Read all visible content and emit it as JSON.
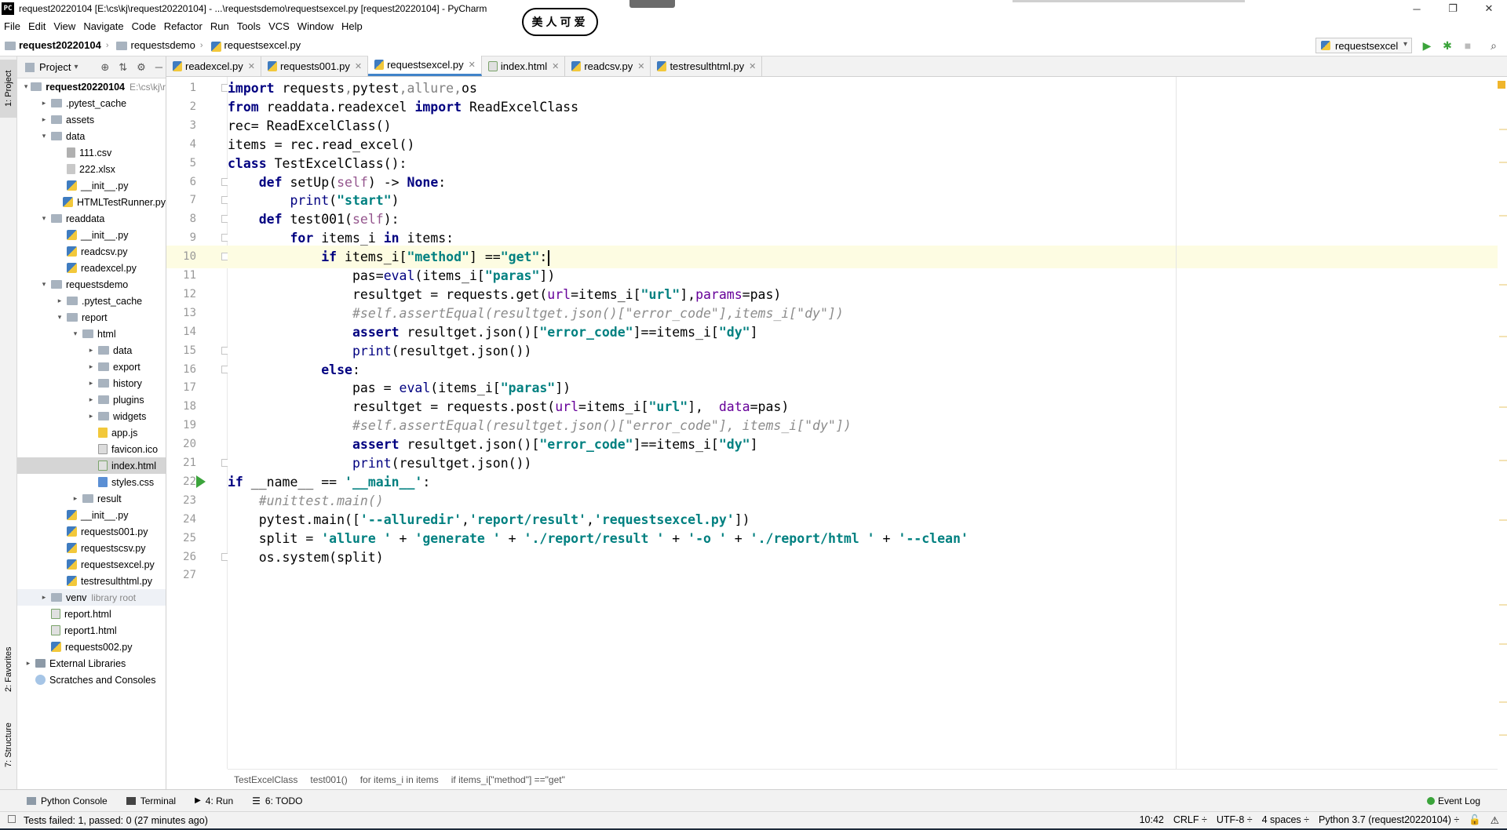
{
  "window": {
    "title": "request20220104 [E:\\cs\\kj\\request20220104] - ...\\requestsdemo\\requestsexcel.py [request20220104] - PyCharm",
    "app_icon_text": "PC",
    "controls": [
      "─",
      "❐",
      "✕"
    ],
    "stamp_text": "美人可爱"
  },
  "menu": [
    "File",
    "Edit",
    "View",
    "Navigate",
    "Code",
    "Refactor",
    "Run",
    "Tools",
    "VCS",
    "Window",
    "Help"
  ],
  "breadcrumb": [
    "request20220104",
    "requestsdemo",
    "requestsexcel.py"
  ],
  "run_config": "requestsexcel",
  "left_stripe": {
    "project": "1: Project",
    "favorites": "2: Favorites",
    "structure": "7: Structure"
  },
  "project_panel": {
    "title": "Project",
    "tree": [
      {
        "label": "request20220104",
        "hint": "E:\\cs\\kj\\r",
        "icon": "folder",
        "level": 0,
        "arrow": "▾",
        "bold": true
      },
      {
        "label": ".pytest_cache",
        "icon": "folder",
        "level": 1,
        "arrow": "▸"
      },
      {
        "label": "assets",
        "icon": "folder",
        "level": 1,
        "arrow": "▸"
      },
      {
        "label": "data",
        "icon": "folder",
        "level": 1,
        "arrow": "▾"
      },
      {
        "label": "111.csv",
        "icon": "csv",
        "level": 2,
        "arrow": ""
      },
      {
        "label": "222.xlsx",
        "icon": "xlsx",
        "level": 2,
        "arrow": ""
      },
      {
        "label": "__init__.py",
        "icon": "py",
        "level": 2,
        "arrow": ""
      },
      {
        "label": "HTMLTestRunner.py",
        "icon": "py",
        "level": 2,
        "arrow": ""
      },
      {
        "label": "readdata",
        "icon": "folder",
        "level": 1,
        "arrow": "▾"
      },
      {
        "label": "__init__.py",
        "icon": "py",
        "level": 2,
        "arrow": ""
      },
      {
        "label": "readcsv.py",
        "icon": "py",
        "level": 2,
        "arrow": ""
      },
      {
        "label": "readexcel.py",
        "icon": "py",
        "level": 2,
        "arrow": ""
      },
      {
        "label": "requestsdemo",
        "icon": "folder",
        "level": 1,
        "arrow": "▾"
      },
      {
        "label": ".pytest_cache",
        "icon": "folder",
        "level": 2,
        "arrow": "▸"
      },
      {
        "label": "report",
        "icon": "folder",
        "level": 2,
        "arrow": "▾"
      },
      {
        "label": "html",
        "icon": "folder",
        "level": 3,
        "arrow": "▾"
      },
      {
        "label": "data",
        "icon": "folder",
        "level": 4,
        "arrow": "▸"
      },
      {
        "label": "export",
        "icon": "folder",
        "level": 4,
        "arrow": "▸"
      },
      {
        "label": "history",
        "icon": "folder",
        "level": 4,
        "arrow": "▸"
      },
      {
        "label": "plugins",
        "icon": "folder",
        "level": 4,
        "arrow": "▸"
      },
      {
        "label": "widgets",
        "icon": "folder",
        "level": 4,
        "arrow": "▸"
      },
      {
        "label": "app.js",
        "icon": "js",
        "level": 4,
        "arrow": ""
      },
      {
        "label": "favicon.ico",
        "icon": "ico",
        "level": 4,
        "arrow": ""
      },
      {
        "label": "index.html",
        "icon": "html",
        "level": 4,
        "arrow": "",
        "selected": true
      },
      {
        "label": "styles.css",
        "icon": "css",
        "level": 4,
        "arrow": ""
      },
      {
        "label": "result",
        "icon": "folder",
        "level": 3,
        "arrow": "▸"
      },
      {
        "label": "__init__.py",
        "icon": "py",
        "level": 2,
        "arrow": ""
      },
      {
        "label": "requests001.py",
        "icon": "py",
        "level": 2,
        "arrow": ""
      },
      {
        "label": "requestscsv.py",
        "icon": "py",
        "level": 2,
        "arrow": ""
      },
      {
        "label": "requestsexcel.py",
        "icon": "py",
        "level": 2,
        "arrow": ""
      },
      {
        "label": "testresulthtml.py",
        "icon": "py",
        "level": 2,
        "arrow": ""
      },
      {
        "label": "venv",
        "hint": "library root",
        "icon": "folder",
        "level": 1,
        "arrow": "▸",
        "shaded": true
      },
      {
        "label": "report.html",
        "icon": "html",
        "level": 1,
        "arrow": ""
      },
      {
        "label": "report1.html",
        "icon": "html",
        "level": 1,
        "arrow": ""
      },
      {
        "label": "requests002.py",
        "icon": "py",
        "level": 1,
        "arrow": ""
      },
      {
        "label": "External Libraries",
        "icon": "lib",
        "level": 0,
        "arrow": "▸"
      },
      {
        "label": "Scratches and Consoles",
        "icon": "scratch",
        "level": 0,
        "arrow": ""
      }
    ]
  },
  "tabs": [
    {
      "label": "readexcel.py",
      "icon": "py"
    },
    {
      "label": "requests001.py",
      "icon": "py"
    },
    {
      "label": "requestsexcel.py",
      "icon": "py",
      "active": true
    },
    {
      "label": "index.html",
      "icon": "html"
    },
    {
      "label": "readcsv.py",
      "icon": "py"
    },
    {
      "label": "testresulthtml.py",
      "icon": "py"
    }
  ],
  "editor": {
    "current_line": 10,
    "run_line": 22,
    "fold_lines": [
      1,
      6,
      7,
      8,
      9,
      10,
      15,
      16,
      21,
      26
    ],
    "lines": [
      [
        [
          "kw",
          "import"
        ],
        [
          "t",
          " requests"
        ],
        [
          "dim",
          ","
        ],
        [
          "t",
          "pytest"
        ],
        [
          "dim",
          ","
        ],
        [
          "dim",
          "allure"
        ],
        [
          "dim",
          ","
        ],
        [
          "t",
          "os"
        ]
      ],
      [
        [
          "kw",
          "from"
        ],
        [
          "t",
          " readdata.readexcel "
        ],
        [
          "kw",
          "import"
        ],
        [
          "t",
          " ReadExcelClass"
        ]
      ],
      [
        [
          "t",
          "rec= ReadExcelClass()"
        ]
      ],
      [
        [
          "t",
          "items = rec.read_excel()"
        ]
      ],
      [
        [
          "kw",
          "class"
        ],
        [
          "t",
          " TestExcelClass():"
        ]
      ],
      [
        [
          "t",
          "    "
        ],
        [
          "kw",
          "def"
        ],
        [
          "t",
          " setUp("
        ],
        [
          "self",
          "self"
        ],
        [
          "t",
          ") -> "
        ],
        [
          "kw",
          "None"
        ],
        [
          "t",
          ":"
        ]
      ],
      [
        [
          "t",
          "        "
        ],
        [
          "builtin",
          "print"
        ],
        [
          "t",
          "("
        ],
        [
          "str",
          "\"start\""
        ],
        [
          "t",
          ")"
        ]
      ],
      [
        [
          "t",
          "    "
        ],
        [
          "kw",
          "def"
        ],
        [
          "t",
          " test001("
        ],
        [
          "self",
          "self"
        ],
        [
          "t",
          "):"
        ]
      ],
      [
        [
          "t",
          "        "
        ],
        [
          "kw",
          "for"
        ],
        [
          "t",
          " items_i "
        ],
        [
          "kw",
          "in"
        ],
        [
          "t",
          " items:"
        ]
      ],
      [
        [
          "t",
          "            "
        ],
        [
          "kw",
          "if"
        ],
        [
          "t",
          " items_i["
        ],
        [
          "str",
          "\"method\""
        ],
        [
          "t",
          "] =="
        ],
        [
          "str",
          "\"get\""
        ],
        [
          "t",
          ":"
        ],
        [
          "caret",
          ""
        ]
      ],
      [
        [
          "t",
          "                pas="
        ],
        [
          "builtin",
          "eval"
        ],
        [
          "t",
          "(items_i["
        ],
        [
          "str",
          "\"paras\""
        ],
        [
          "t",
          "])"
        ]
      ],
      [
        [
          "t",
          "                resultget = requests.get("
        ],
        [
          "param",
          "url"
        ],
        [
          "t",
          "=items_i["
        ],
        [
          "str",
          "\"url\""
        ],
        [
          "t",
          "],"
        ],
        [
          "param",
          "params"
        ],
        [
          "t",
          "=pas)"
        ]
      ],
      [
        [
          "t",
          "                "
        ],
        [
          "cmt",
          "#self.assertEqual(resultget.json()[\"error_code\"],items_i[\"dy\"])"
        ]
      ],
      [
        [
          "t",
          "                "
        ],
        [
          "kw",
          "assert"
        ],
        [
          "t",
          " resultget.json()["
        ],
        [
          "str",
          "\"error_code\""
        ],
        [
          "t",
          "]==items_i["
        ],
        [
          "str",
          "\"dy\""
        ],
        [
          "t",
          "]"
        ]
      ],
      [
        [
          "t",
          "                "
        ],
        [
          "builtin",
          "print"
        ],
        [
          "t",
          "(resultget.json())"
        ]
      ],
      [
        [
          "t",
          "            "
        ],
        [
          "kw",
          "else"
        ],
        [
          "t",
          ":"
        ]
      ],
      [
        [
          "t",
          "                pas = "
        ],
        [
          "builtin",
          "eval"
        ],
        [
          "t",
          "(items_i["
        ],
        [
          "str",
          "\"paras\""
        ],
        [
          "t",
          "])"
        ]
      ],
      [
        [
          "t",
          "                resultget = requests.post("
        ],
        [
          "param",
          "url"
        ],
        [
          "t",
          "=items_i["
        ],
        [
          "str",
          "\"url\""
        ],
        [
          "t",
          "],  "
        ],
        [
          "param",
          "data"
        ],
        [
          "t",
          "=pas)"
        ]
      ],
      [
        [
          "t",
          "                "
        ],
        [
          "cmt",
          "#self.assertEqual(resultget.json()[\"error_code\"], items_i[\"dy\"])"
        ]
      ],
      [
        [
          "t",
          "                "
        ],
        [
          "kw",
          "assert"
        ],
        [
          "t",
          " resultget.json()["
        ],
        [
          "str",
          "\"error_code\""
        ],
        [
          "t",
          "]==items_i["
        ],
        [
          "str",
          "\"dy\""
        ],
        [
          "t",
          "]"
        ]
      ],
      [
        [
          "t",
          "                "
        ],
        [
          "builtin",
          "print"
        ],
        [
          "t",
          "(resultget.json())"
        ]
      ],
      [
        [
          "kw",
          "if"
        ],
        [
          "t",
          " __name__ == "
        ],
        [
          "str",
          "'__main__'"
        ],
        [
          "t",
          ":"
        ]
      ],
      [
        [
          "t",
          "    "
        ],
        [
          "cmt",
          "#unittest.main()"
        ]
      ],
      [
        [
          "t",
          "    pytest.main(["
        ],
        [
          "str",
          "'--alluredir'"
        ],
        [
          "t",
          ","
        ],
        [
          "str",
          "'report/result'"
        ],
        [
          "t",
          ","
        ],
        [
          "str",
          "'requestsexcel.py'"
        ],
        [
          "t",
          "])"
        ]
      ],
      [
        [
          "t",
          "    split = "
        ],
        [
          "str",
          "'allure '"
        ],
        [
          "t",
          " + "
        ],
        [
          "str",
          "'generate '"
        ],
        [
          "t",
          " + "
        ],
        [
          "str",
          "'./report/result '"
        ],
        [
          "t",
          " + "
        ],
        [
          "str",
          "'-o '"
        ],
        [
          "t",
          " + "
        ],
        [
          "str",
          "'./report/html '"
        ],
        [
          "t",
          " + "
        ],
        [
          "str",
          "'--clean'"
        ]
      ],
      [
        [
          "t",
          "    os.system(split)"
        ]
      ],
      [
        [
          "t",
          ""
        ]
      ]
    ]
  },
  "code_breadcrumb": [
    "TestExcelClass",
    "test001()",
    "for items_i in items",
    "if items_i[\"method\"] ==\"get\""
  ],
  "bottom_tools": [
    {
      "label": "Python Console"
    },
    {
      "label": "Terminal"
    },
    {
      "label": "4: Run"
    },
    {
      "label": "6: TODO"
    }
  ],
  "event_log": "Event Log",
  "status": {
    "message": "Tests failed: 1, passed: 0 (27 minutes ago)",
    "position": "10:42",
    "line_sep": "CRLF ÷",
    "encoding": "UTF-8 ÷",
    "indent": "4 spaces ÷",
    "interpreter": "Python 3.7 (request20220104) ÷"
  }
}
